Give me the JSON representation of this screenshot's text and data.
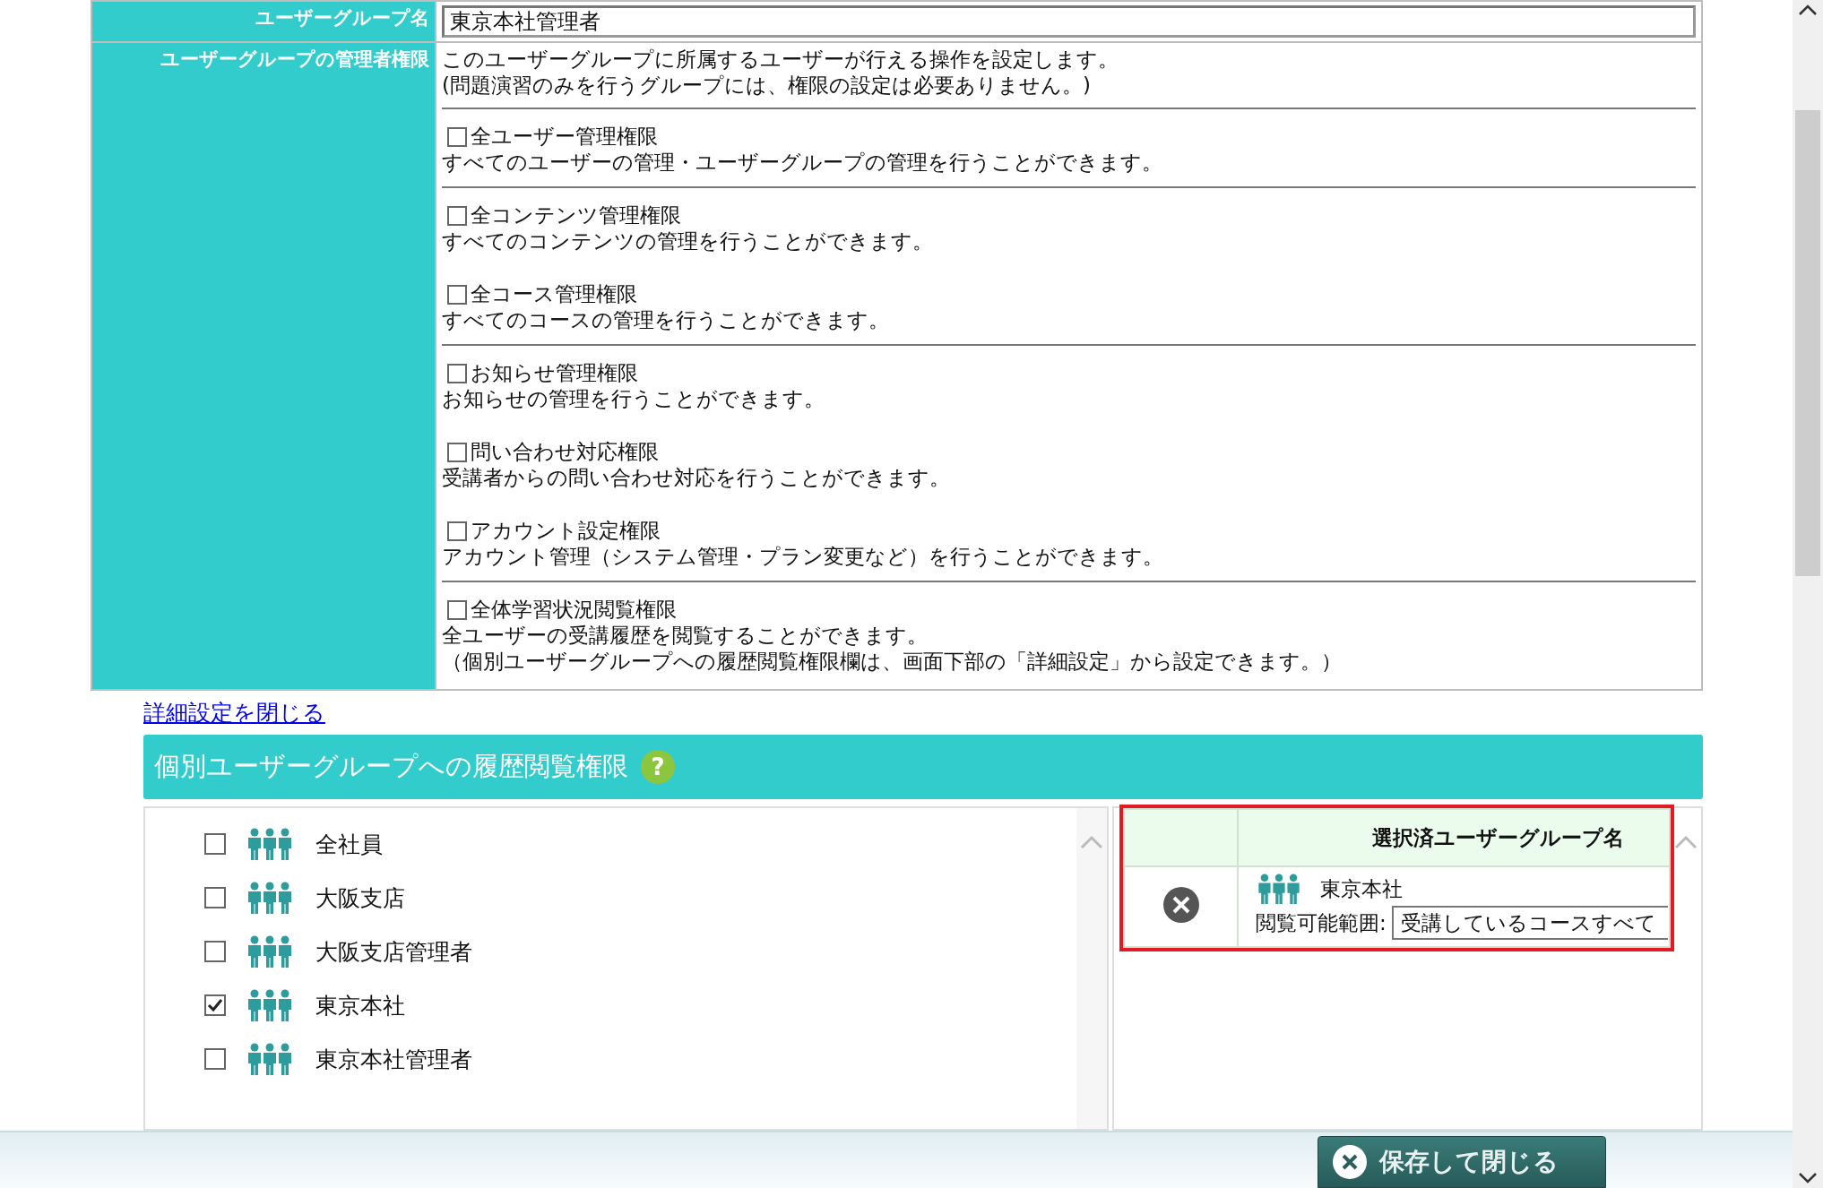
{
  "group_name": {
    "label": "ユーザーグループ名",
    "value": "東京本社管理者"
  },
  "admin_permissions": {
    "label": "ユーザーグループの管理者権限",
    "intro": [
      "このユーザーグループに所属するユーザーが行える操作を設定します。",
      "(問題演習のみを行うグループには、権限の設定は必要ありません。)"
    ],
    "sections": [
      {
        "items": [
          {
            "name": "全ユーザー管理権限",
            "checked": false,
            "description": [
              "すべてのユーザーの管理・ユーザーグループの管理を行うことができます。"
            ]
          }
        ]
      },
      {
        "items": [
          {
            "name": "全コンテンツ管理権限",
            "checked": false,
            "description": [
              "すべてのコンテンツの管理を行うことができます。"
            ]
          },
          {
            "name": "全コース管理権限",
            "checked": false,
            "description": [
              "すべてのコースの管理を行うことができます。"
            ]
          }
        ]
      },
      {
        "items": [
          {
            "name": "お知らせ管理権限",
            "checked": false,
            "description": [
              "お知らせの管理を行うことができます。"
            ]
          },
          {
            "name": "問い合わせ対応権限",
            "checked": false,
            "description": [
              "受講者からの問い合わせ対応を行うことができます。"
            ]
          },
          {
            "name": "アカウント設定権限",
            "checked": false,
            "description": [
              "アカウント管理（システム管理・プラン変更など）を行うことができます。"
            ]
          }
        ]
      },
      {
        "items": [
          {
            "name": "全体学習状況閲覧権限",
            "checked": false,
            "description": [
              "全ユーザーの受講履歴を閲覧することができます。",
              "（個別ユーザーグループへの履歴閲覧権限欄は、画面下部の「詳細設定」から設定できます。）"
            ]
          }
        ]
      }
    ]
  },
  "close_details_link": "詳細設定を閉じる",
  "history_section": {
    "title": "個別ユーザーグループへの履歴閲覧権限",
    "help": "?",
    "groups": [
      {
        "name": "全社員",
        "checked": false
      },
      {
        "name": "大阪支店",
        "checked": false
      },
      {
        "name": "大阪支店管理者",
        "checked": false
      },
      {
        "name": "東京本社",
        "checked": true
      },
      {
        "name": "東京本社管理者",
        "checked": false
      }
    ],
    "selected_table": {
      "column_header": "選択済ユーザーグループ名",
      "rows": [
        {
          "name": "東京本社",
          "scope_label": "閲覧可能範囲:",
          "scope_value": "受講しているコースすべて"
        }
      ]
    }
  },
  "footer": {
    "save_button": "保存して閉じる"
  }
}
